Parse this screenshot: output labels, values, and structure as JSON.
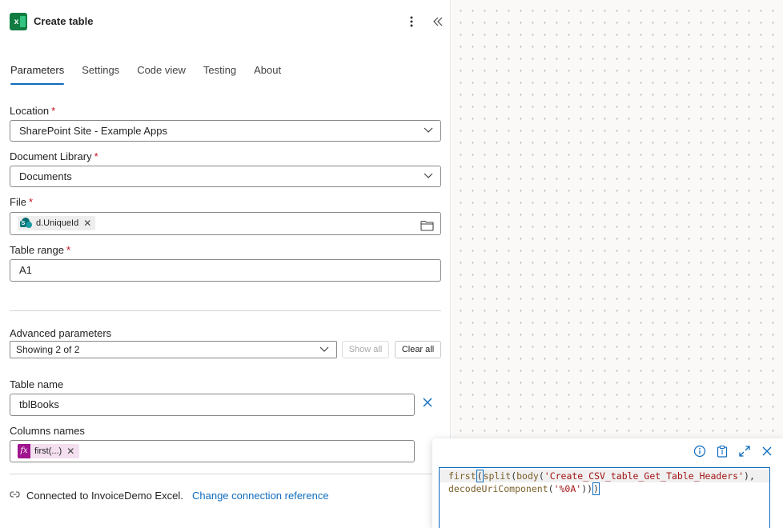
{
  "header": {
    "app_icon": "excel-icon",
    "title": "Create table",
    "more_icon": "more-vertical-icon",
    "collapse_icon": "double-chevron-left-icon"
  },
  "tabs": [
    {
      "label": "Parameters",
      "active": true
    },
    {
      "label": "Settings",
      "active": false
    },
    {
      "label": "Code view",
      "active": false
    },
    {
      "label": "Testing",
      "active": false
    },
    {
      "label": "About",
      "active": false
    }
  ],
  "fields": {
    "location": {
      "label": "Location",
      "required_mark": "*",
      "value": "SharePoint Site - Example Apps"
    },
    "document_library": {
      "label": "Document Library",
      "required_mark": "*",
      "value": "Documents"
    },
    "file": {
      "label": "File",
      "required_mark": "*",
      "token": "d.UniqueId",
      "token_icon": "sharepoint-icon",
      "browse_icon": "folder-icon"
    },
    "table_range": {
      "label": "Table range",
      "required_mark": "*",
      "value": "A1"
    }
  },
  "advanced": {
    "label": "Advanced parameters",
    "selected": "Showing 2 of 2",
    "show_all": "Show all",
    "clear_all": "Clear all"
  },
  "table_name": {
    "label": "Table name",
    "value": "tblBooks"
  },
  "columns_names": {
    "label": "Columns names",
    "token": "first(...)",
    "token_icon": "fx-icon"
  },
  "connection": {
    "text": "Connected to InvoiceDemo Excel.",
    "link": "Change connection reference",
    "icon": "connection-link-icon"
  },
  "expression": {
    "tools": [
      "info-icon",
      "clipboard-icon",
      "expand-icon",
      "close-icon"
    ],
    "line1": {
      "fn1": "first",
      "p1": "(",
      "fn2": "split",
      "p2": "(",
      "fn3": "body",
      "p3": "(",
      "str1": "'Create_CSV_table_Get_Table_Headers'",
      "p4": "),"
    },
    "line2": {
      "fn4": "decodeUriComponent",
      "p5": "(",
      "str2": "'%0A'",
      "p6": "))",
      "p7": ")"
    }
  },
  "colors": {
    "accent": "#0f6cbd",
    "excel": "#107c41",
    "fx": "#a0148e",
    "required": "#c50f1f"
  }
}
